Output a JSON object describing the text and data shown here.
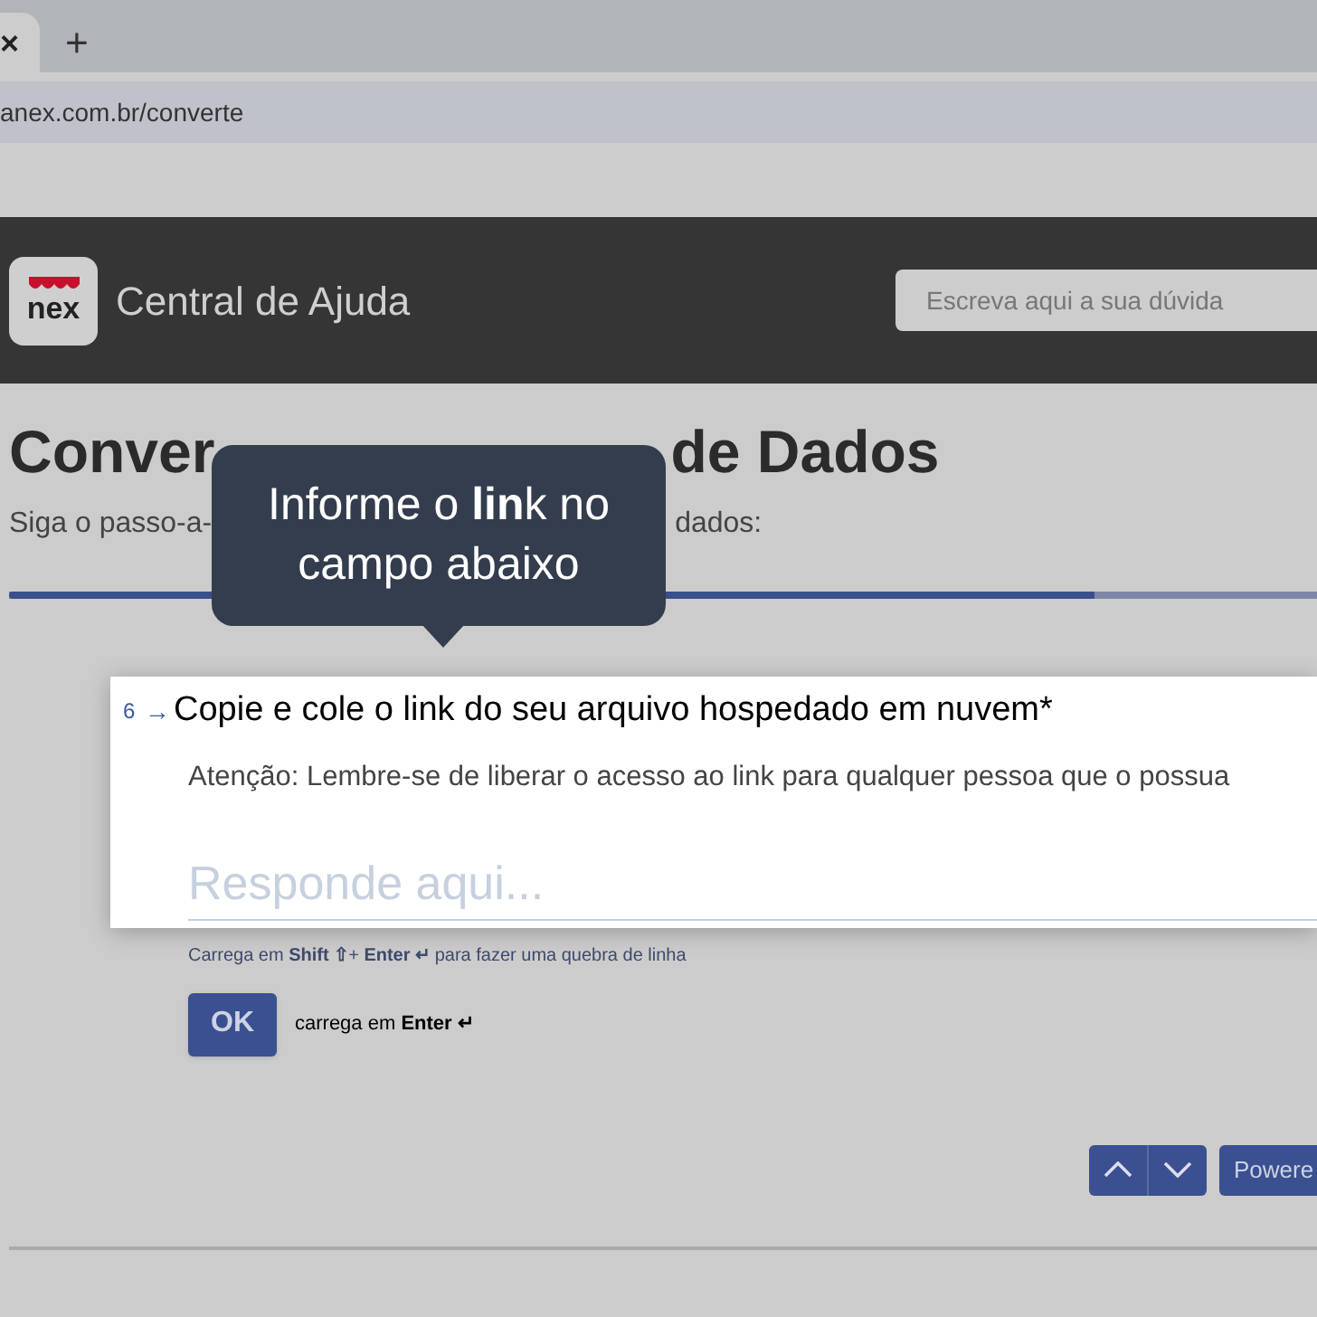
{
  "browser": {
    "tab_close": "×",
    "new_tab": "+",
    "address": "anex.com.br/converte"
  },
  "header": {
    "logo": "nex",
    "title": "Central de Ajuda",
    "search": {
      "placeholder": "Escreva aqui a sua dúvida"
    }
  },
  "page": {
    "title_parts": [
      "Conver",
      "de Dados"
    ],
    "subtitle_parts": [
      "Siga o passo-a-",
      "dados:"
    ],
    "progress": {
      "level": 0.83
    }
  },
  "tooltip": {
    "text": "Informe o **lin**k no campo abaixo"
  },
  "question": {
    "number": "6",
    "arrow": "→",
    "title": "Copie e cole o link do seu arquivo hospedado em nuvem*",
    "note": "Atenção: Lembre-se de liberar o acesso ao link para qualquer pessoa que o possua",
    "answer": {
      "placeholder": "Responde aqui..."
    },
    "hint": "Carrega em **Shift ⇧**+ **Enter ↵** para fazer uma quebra de linha"
  },
  "ok": {
    "label": "OK",
    "hint": "carrega em **Enter ↵**"
  },
  "footer": {
    "powered": "Powere"
  }
}
